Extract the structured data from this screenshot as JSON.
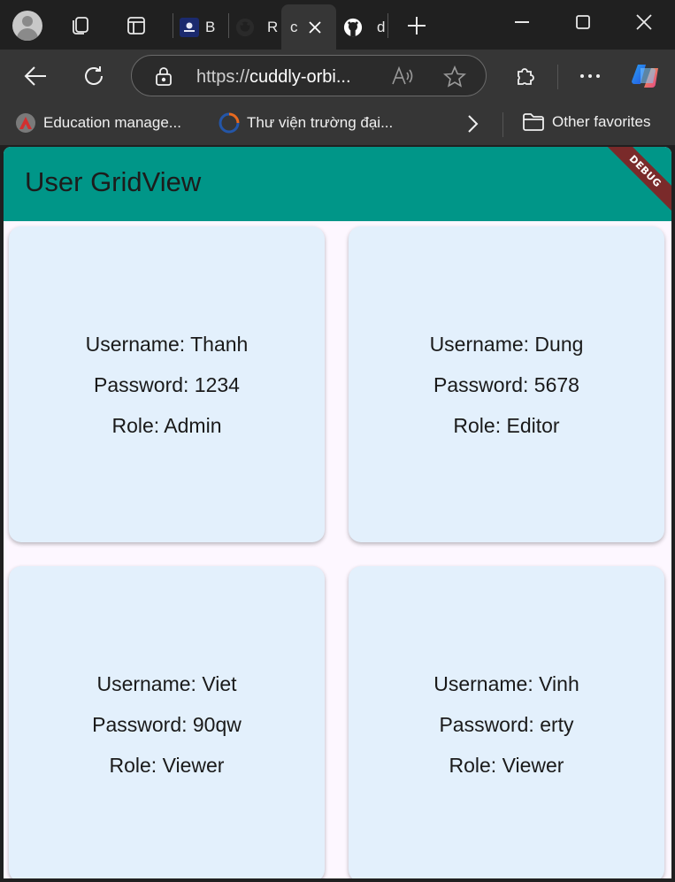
{
  "browser": {
    "tabs": [
      {
        "label": "B",
        "favicon": "site-favicon",
        "active": false
      },
      {
        "label": "R",
        "favicon": "github-icon",
        "active": false
      },
      {
        "label": "c",
        "favicon": "",
        "active": true
      },
      {
        "label": "d",
        "favicon": "github-icon",
        "active": false
      }
    ],
    "url_prefix": "https://",
    "url_host": "cuddly-orbi...",
    "favorites": [
      {
        "label": "Education manage...",
        "icon": "education-site-icon"
      },
      {
        "label": "Thư viện trường đại...",
        "icon": "library-site-icon"
      }
    ],
    "other_favorites_label": "Other favorites",
    "colors": {
      "chrome_dark": "#202020",
      "toolbar": "#363636"
    }
  },
  "app": {
    "title": "User GridView",
    "debug_banner": "DEBUG",
    "colors": {
      "appbar": "#009688",
      "card": "#e3f0fc",
      "background": "#fdf7ff"
    },
    "users": [
      {
        "username": "Username: Thanh",
        "password": "Password: 1234",
        "role": "Role: Admin"
      },
      {
        "username": "Username: Dung",
        "password": "Password: 5678",
        "role": "Role: Editor"
      },
      {
        "username": "Username: Viet",
        "password": "Password: 90qw",
        "role": "Role: Viewer"
      },
      {
        "username": "Username: Vinh",
        "password": "Password: erty",
        "role": "Role: Viewer"
      }
    ]
  }
}
